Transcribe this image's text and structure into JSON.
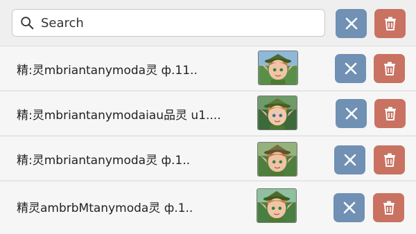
{
  "search": {
    "placeholder": "Search",
    "value": ""
  },
  "icons": {
    "search": "search-icon",
    "clear": "close-icon",
    "delete": "trash-icon",
    "thumbnail": "elf-portrait-thumbnail"
  },
  "colors": {
    "clear_button": "#7090b4",
    "delete_button": "#c97261",
    "background": "#eeeeee"
  },
  "rows": [
    {
      "label": "精:灵mbriantanymoda灵  ф.11.."
    },
    {
      "label": "精:灵mbriantanymodaiau品灵  u1...."
    },
    {
      "label": "精:灵mbriantanymoda灵  ф.1.."
    },
    {
      "label": "精灵ambrbMtanymoda灵  ф.1.."
    }
  ]
}
